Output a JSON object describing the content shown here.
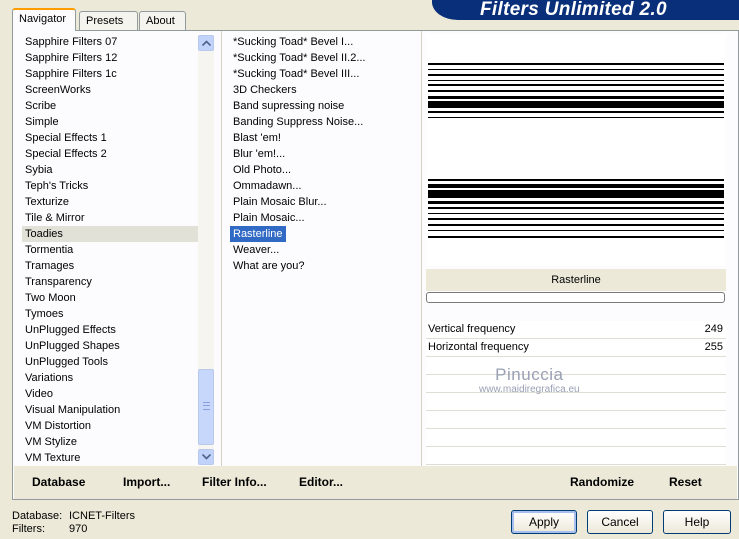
{
  "tabs": [
    {
      "label": "Navigator",
      "active": true
    },
    {
      "label": "Presets",
      "active": false
    },
    {
      "label": "About",
      "active": false
    }
  ],
  "banner": {
    "title": "Filters Unlimited 2.0"
  },
  "categories": [
    "Sapphire Filters 07",
    "Sapphire Filters 12",
    "Sapphire Filters 1c",
    "ScreenWorks",
    "Scribe",
    "Simple",
    "Special Effects 1",
    "Special Effects 2",
    "Sybia",
    "Teph's Tricks",
    "Texturize",
    "Tile & Mirror",
    "Toadies",
    "Tormentia",
    "Tramages",
    "Transparency",
    "Two Moon",
    "Tymoes",
    "UnPlugged Effects",
    "UnPlugged Shapes",
    "UnPlugged Tools",
    "Variations",
    "Video",
    "Visual Manipulation",
    "VM Distortion",
    "VM Stylize",
    "VM Texture"
  ],
  "selected_category": "Toadies",
  "filters": [
    "*Sucking Toad*  Bevel I...",
    "*Sucking Toad*  Bevel II.2...",
    "*Sucking Toad*  Bevel III...",
    "3D Checkers",
    "Band supressing noise",
    "Banding Suppress Noise...",
    "Blast 'em!",
    "Blur 'em!...",
    "Old Photo...",
    "Ommadawn...",
    "Plain Mosaic Blur...",
    "Plain Mosaic...",
    "Rasterline",
    "Weaver...",
    "What are you?"
  ],
  "selected_filter": "Rasterline",
  "preview": {
    "filter_name": "Rasterline"
  },
  "parameters": [
    {
      "label": "Vertical frequency",
      "value": "249"
    },
    {
      "label": "Horizontal frequency",
      "value": "255"
    }
  ],
  "watermark": {
    "line1": "Pinuccia",
    "line2": "www.maidiregrafica.eu"
  },
  "toolbar": {
    "database": "Database",
    "import": "Import...",
    "filter_info": "Filter Info...",
    "editor": "Editor...",
    "randomize": "Randomize",
    "reset": "Reset"
  },
  "footer": {
    "database_label": "Database:",
    "database_value": "ICNET-Filters",
    "filters_label": "Filters:",
    "filters_value": "970",
    "apply": "Apply",
    "cancel": "Cancel",
    "help": "Help"
  },
  "colors": {
    "selection": "#316ac5",
    "banner": "#0a2f7a",
    "active_tab_accent": "#ff9c00"
  }
}
